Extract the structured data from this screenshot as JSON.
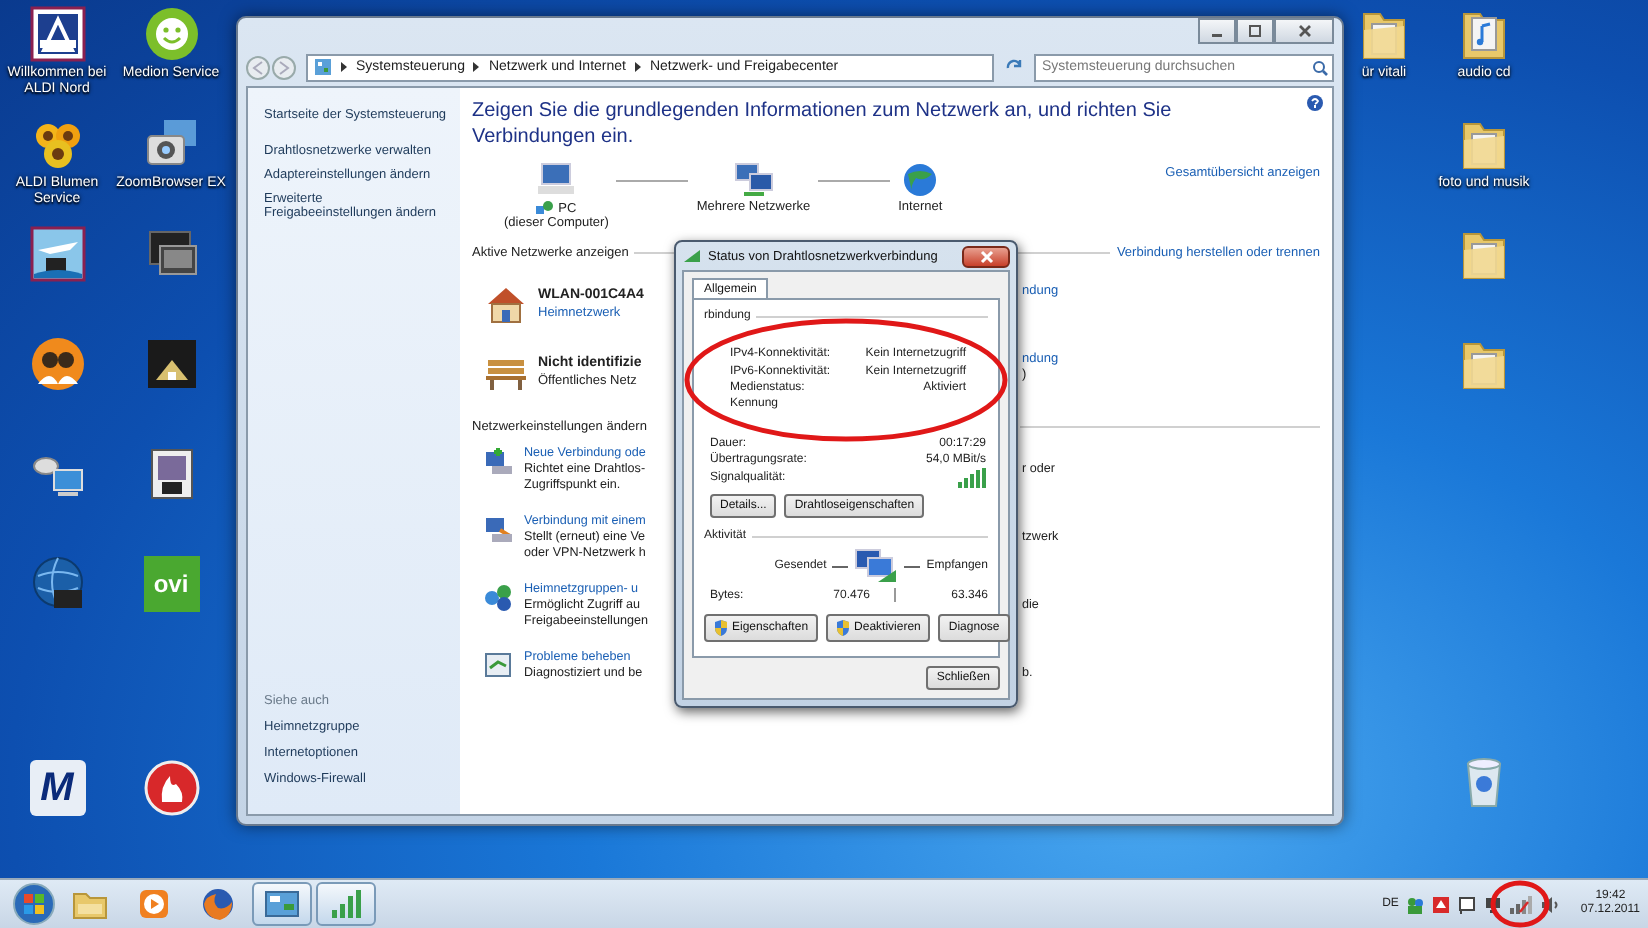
{
  "desktop": {
    "left_icons": [
      {
        "kind": "aldi",
        "label": "Willkommen bei ALDI Nord"
      },
      {
        "kind": "headset",
        "label": "Medion Service"
      },
      {
        "kind": "flowers",
        "label": "ALDI Blumen Service"
      },
      {
        "kind": "camera",
        "label": "ZoomBrowser EX"
      },
      {
        "kind": "plane"
      },
      {
        "kind": "monitor"
      },
      {
        "kind": "people"
      },
      {
        "kind": "dark"
      },
      {
        "kind": "satellite"
      },
      {
        "kind": "photo"
      },
      {
        "kind": "globe"
      },
      {
        "kind": "tile",
        "icon_text": "ovi"
      }
    ],
    "bottom_icons": [
      {
        "kind": "letter",
        "icon_text": "M"
      },
      {
        "kind": "flame"
      }
    ],
    "edge_icons": [
      {
        "kind": "folder",
        "label": "ür vitali"
      }
    ],
    "right_icons": [
      {
        "kind": "music_folder",
        "label": "audio cd"
      },
      {
        "kind": "folder",
        "label": "foto und musik"
      },
      {
        "kind": "folder"
      },
      {
        "kind": "folder"
      }
    ],
    "right_bottom_icons": [
      {
        "kind": "bin"
      }
    ]
  },
  "window": {
    "breadcrumb": [
      "Systemsteuerung",
      "Netzwerk und Internet",
      "Netzwerk- und Freigabecenter"
    ],
    "search": {
      "placeholder": "Systemsteuerung durchsuchen"
    },
    "sidebar": {
      "items": [
        "Startseite der Systemsteuerung",
        "Drahtlosnetzwerke verwalten",
        "Adaptereinstellungen ändern",
        "Erweiterte Freigabeeinstellungen ändern"
      ],
      "see_also_title": "Siehe auch",
      "see_also": [
        "Heimnetzgruppe",
        "Internetoptionen",
        "Windows-Firewall"
      ]
    },
    "heading": "Zeigen Sie die grundlegenden Informationen zum Netzwerk an, und richten Sie Verbindungen ein.",
    "map": {
      "nodes": [
        {
          "kind": "computer",
          "label": "PC",
          "sublabel": "(dieser Computer)"
        },
        {
          "kind": "network",
          "label": "Mehrere Netzwerke"
        },
        {
          "kind": "internet",
          "label": "Internet"
        }
      ],
      "link": "Gesamtübersicht anzeigen"
    },
    "active_networks": {
      "title": "Aktive Netzwerke anzeigen",
      "link": "Verbindung herstellen oder trennen",
      "networks": [
        {
          "kind": "home",
          "name": "WLAN-001C4A4",
          "type": "Heimnetzwerk",
          "right_text": [
            "ndung"
          ]
        },
        {
          "kind": "public",
          "name": "Nicht identifizie",
          "type": "Öffentliches Netz",
          "right_text": [
            "ndung",
            ")"
          ]
        }
      ]
    },
    "settings": {
      "title": "Netzwerkeinstellungen ändern",
      "items": [
        {
          "kind": "new",
          "title": "Neue Verbindung ode",
          "lines": [
            "Richtet eine Drahtlos-",
            "Zugriffspunkt ein."
          ],
          "right_text": "r oder"
        },
        {
          "kind": "connect",
          "title": "Verbindung mit einem",
          "lines": [
            "Stellt (erneut) eine Ve",
            "oder VPN-Netzwerk h"
          ],
          "right_text": "tzwerk"
        },
        {
          "kind": "homegroup",
          "title": "Heimnetzgruppen- u",
          "lines": [
            "Ermöglicht Zugriff au",
            "Freigabeeinstellungen"
          ],
          "right_text": "die"
        },
        {
          "kind": "troubleshoot",
          "title": "Probleme beheben",
          "lines": [
            "Diagnostiziert und be"
          ],
          "right_text": "b."
        }
      ]
    }
  },
  "dialog": {
    "title": "Status von Drahtlosnetzwerkverbindung",
    "tabs": [
      {
        "label": "Allgemein",
        "selected": true
      }
    ],
    "connection": {
      "title": "rbindung",
      "rows": [
        {
          "kind": "text",
          "label": "IPv4-Konnektivität:",
          "value": "Kein Internetzugriff"
        },
        {
          "kind": "text",
          "label": "IPv6-Konnektivität:",
          "value": "Kein Internetzugriff"
        },
        {
          "kind": "text",
          "label": "Medienstatus:",
          "value": "Aktiviert"
        },
        {
          "kind": "text",
          "label": "Kennung"
        },
        {
          "kind": "text",
          "label": "Dauer:",
          "value": "00:17:29"
        },
        {
          "kind": "text",
          "label": "Übertragungsrate:",
          "value": "54,0 MBit/s"
        },
        {
          "kind": "signal",
          "label": "Signalqualität:"
        }
      ],
      "buttons": [
        "Details...",
        "Drahtloseigenschaften"
      ]
    },
    "activity": {
      "title": "Aktivität",
      "sent_label": "Gesendet",
      "received_label": "Empfangen",
      "bytes_label": "Bytes:",
      "sent": "70.476",
      "received": "63.346"
    },
    "buttons": [
      {
        "label": "Eigenschaften",
        "shield": true
      },
      {
        "label": "Deaktivieren",
        "shield": true
      },
      {
        "label": "Diagnose",
        "shield": false
      }
    ],
    "close_button": "Schließen"
  },
  "taskbar": {
    "pinned": [
      {
        "kind": "explorer",
        "active": false
      },
      {
        "kind": "media",
        "active": false
      },
      {
        "kind": "firefox",
        "active": false
      },
      {
        "kind": "control_panel",
        "active": true
      },
      {
        "kind": "wlan",
        "active": true
      }
    ],
    "tray": {
      "language": "DE",
      "time": "19:42",
      "date": "07.12.2011"
    }
  },
  "annotations": {
    "dialog_ellipse": true,
    "tray_circle": true
  }
}
